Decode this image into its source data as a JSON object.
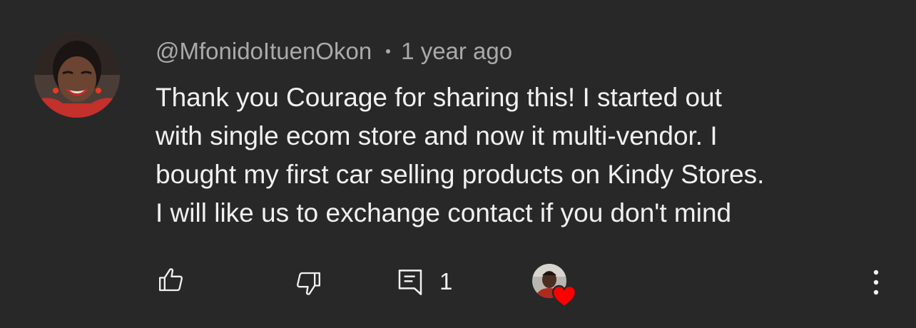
{
  "comment": {
    "author": "@MfonidoItuenOkon",
    "timestamp": "1 year ago",
    "text_lines": [
      "Thank you Courage for sharing this! I started out",
      "with single ecom store and now it multi-vendor. I",
      "bought my first car selling products on Kindy Stores.",
      "I will like us to exchange contact if you don't mind"
    ]
  },
  "actions": {
    "like_icon": "thumbs-up-icon",
    "dislike_icon": "thumbs-down-icon",
    "reply_icon": "reply-comment-icon",
    "reply_count": "1",
    "creator_heart": "creator-heart-badge",
    "more_icon": "more-vertical-icon"
  },
  "colors": {
    "background": "#282828",
    "text_primary": "#f1f1f1",
    "text_secondary": "#aaaaaa",
    "heart_red": "#ff0000"
  }
}
